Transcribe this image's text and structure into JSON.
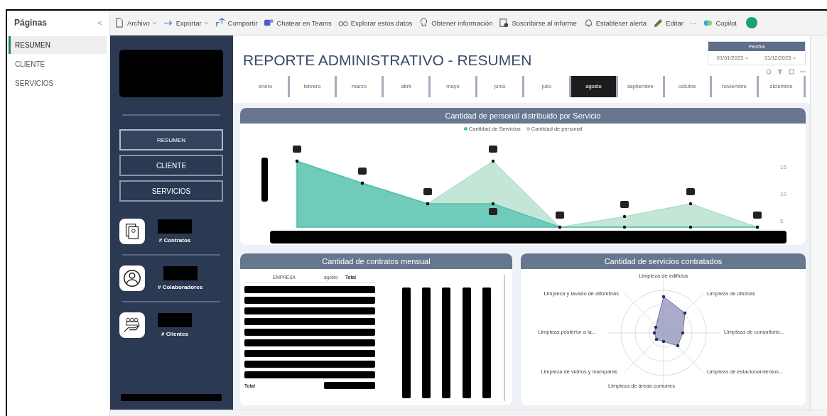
{
  "pages_pane": {
    "title": "Páginas",
    "collapse": "<",
    "items": [
      {
        "label": "RESUMEN",
        "selected": true
      },
      {
        "label": "CLIENTE",
        "selected": false
      },
      {
        "label": "SERVICIOS",
        "selected": false
      }
    ]
  },
  "toolbar": {
    "items": [
      {
        "label": "Archivo",
        "kind": "file",
        "dropdown": true
      },
      {
        "label": "Exportar",
        "kind": "export",
        "dropdown": true
      },
      {
        "label": "Compartir",
        "kind": "share",
        "dropdown": false
      },
      {
        "label": "Chatear en Teams",
        "kind": "teams",
        "dropdown": false
      },
      {
        "label": "Explorar estos datos",
        "kind": "explore",
        "dropdown": false
      },
      {
        "label": "Obtener información",
        "kind": "bulb",
        "dropdown": false
      },
      {
        "label": "Suscribirse al informe",
        "kind": "subscribe",
        "dropdown": false
      },
      {
        "label": "Establecer alerta",
        "kind": "bell",
        "dropdown": false
      },
      {
        "label": "Editar",
        "kind": "pencil",
        "dropdown": false
      },
      {
        "label": "···",
        "kind": "more",
        "dropdown": false
      },
      {
        "label": "Copilot",
        "kind": "copilot",
        "dropdown": false
      }
    ]
  },
  "report": {
    "nav_buttons": [
      {
        "label": "RESUMEN",
        "selected": true
      },
      {
        "label": "CLIENTE",
        "selected": false
      },
      {
        "label": "SERVICIOS",
        "selected": false
      }
    ],
    "kpis": [
      {
        "label": "# Contratos",
        "kind": "contracts"
      },
      {
        "label": "# Colaboradores",
        "kind": "person"
      },
      {
        "label": "# Clientes",
        "kind": "clients"
      }
    ],
    "title": "REPORTE ADMINISTRATIVO - RESUMEN",
    "date_slicer": {
      "title": "Fecha",
      "start": "01/01/2023",
      "end": "31/12/2023"
    },
    "months": [
      {
        "label": "enero",
        "selected": false
      },
      {
        "label": "febrero",
        "selected": false
      },
      {
        "label": "marzo",
        "selected": false
      },
      {
        "label": "abril",
        "selected": false
      },
      {
        "label": "mayo",
        "selected": false
      },
      {
        "label": "junio",
        "selected": false
      },
      {
        "label": "julio",
        "selected": false
      },
      {
        "label": "agosto",
        "selected": true
      },
      {
        "label": "septiembre",
        "selected": false
      },
      {
        "label": "octubre",
        "selected": false
      },
      {
        "label": "noviembre",
        "selected": false
      },
      {
        "label": "diciembre",
        "selected": false
      }
    ],
    "personal_chart": {
      "title": "Cantidad de personal distribuido por Servicio",
      "legend": [
        {
          "label": "Cantidad de Servicios",
          "color": "#4fbfae"
        },
        {
          "label": "Cantidad de personal",
          "color": "#9dd6bd"
        }
      ],
      "y_ticks": [
        "15",
        "10",
        "5"
      ]
    },
    "contracts_card": {
      "title": "Cantidad de contratos mensual",
      "columns": [
        "EMPRESA",
        "agosto",
        "Total"
      ],
      "total_label": "Total"
    },
    "services_card": {
      "title": "Cantidad de servicios contratados",
      "axis_labels": [
        "Limpieza de edificios",
        "Limpieza y lavado de alfombras",
        "Limpieza de oficinas",
        "Limpieza posterior a la...",
        "Limpieza de consultorio...",
        "Limpieza de vidrios y mamparas",
        "Limpieza de estacionamientos...",
        "Limpieza de áreas comunes"
      ]
    }
  }
}
